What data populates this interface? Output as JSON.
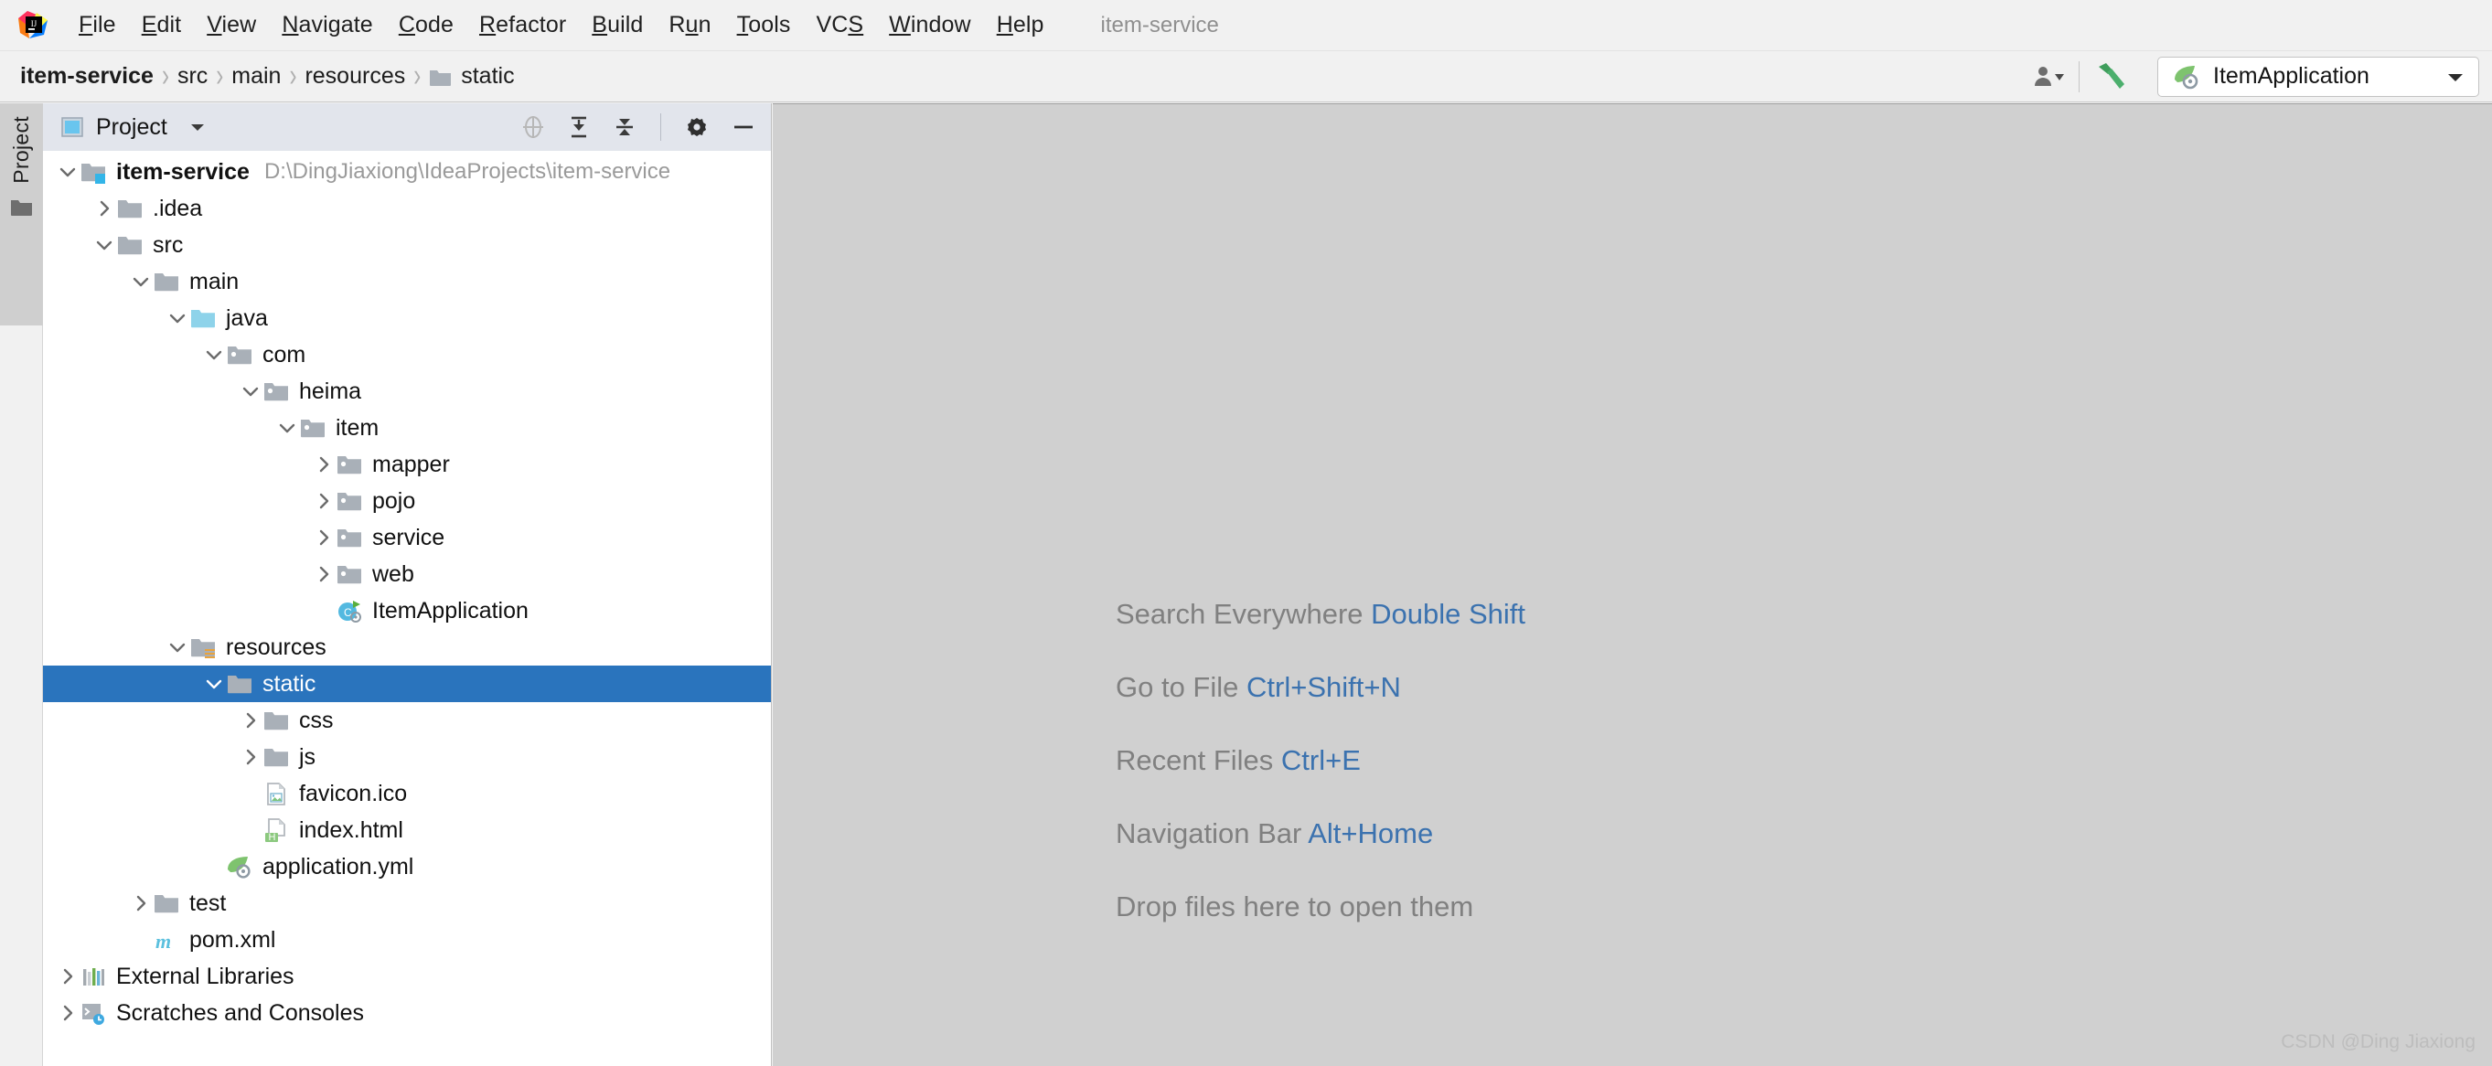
{
  "window": {
    "title": "item-service",
    "logo_icon": "intellij-idea-logo"
  },
  "menubar": {
    "items": [
      {
        "label": "File",
        "mnemonic": "F"
      },
      {
        "label": "Edit",
        "mnemonic": "E"
      },
      {
        "label": "View",
        "mnemonic": "V"
      },
      {
        "label": "Navigate",
        "mnemonic": "N"
      },
      {
        "label": "Code",
        "mnemonic": "C"
      },
      {
        "label": "Refactor",
        "mnemonic": "R"
      },
      {
        "label": "Build",
        "mnemonic": "B"
      },
      {
        "label": "Run",
        "mnemonic": "u"
      },
      {
        "label": "Tools",
        "mnemonic": "T"
      },
      {
        "label": "VCS",
        "mnemonic": "S"
      },
      {
        "label": "Window",
        "mnemonic": "W"
      },
      {
        "label": "Help",
        "mnemonic": "H"
      }
    ]
  },
  "navbar": {
    "breadcrumbs": [
      {
        "label": "item-service",
        "bold": true,
        "icon": null
      },
      {
        "label": "src",
        "bold": false,
        "icon": null
      },
      {
        "label": "main",
        "bold": false,
        "icon": null
      },
      {
        "label": "resources",
        "bold": false,
        "icon": null
      },
      {
        "label": "static",
        "bold": false,
        "icon": "folder-icon"
      }
    ],
    "separator": "›",
    "actions": {
      "account_icon": "user-account-icon",
      "account_caret_icon": "chevron-down-icon",
      "build_icon": "hammer-build-icon"
    },
    "run_config": {
      "icon": "spring-boot-leaf-icon",
      "label": "ItemApplication",
      "caret_icon": "chevron-down-icon"
    }
  },
  "toolstrip": {
    "active_tab": {
      "label": "Project",
      "icon": "project-folder-icon"
    }
  },
  "panel": {
    "icon": "project-view-icon",
    "title": "Project",
    "caret_icon": "chevron-down-icon",
    "actions": [
      {
        "name": "select-opened-file-icon",
        "label": "Select Opened File"
      },
      {
        "name": "expand-all-icon",
        "label": "Expand All"
      },
      {
        "name": "collapse-all-icon",
        "label": "Collapse All"
      },
      {
        "name": "settings-gear-icon",
        "label": "Settings"
      },
      {
        "name": "hide-minimize-icon",
        "label": "Hide"
      }
    ]
  },
  "tree": {
    "colors": {
      "selection_bg": "#2a74bd",
      "selection_fg": "#ffffff",
      "path_hint_fg": "#9a9a9a",
      "source_root": "#6cc2e0",
      "resource_root": "#e8a33d"
    },
    "rows": [
      {
        "depth": 0,
        "arrow": "down",
        "icon": "module-folder-icon",
        "label": "item-service",
        "bold": true,
        "sub": "D:\\DingJiaxiong\\IdeaProjects\\item-service",
        "selected": false
      },
      {
        "depth": 1,
        "arrow": "right",
        "icon": "folder-icon",
        "label": ".idea",
        "bold": false,
        "sub": "",
        "selected": false
      },
      {
        "depth": 1,
        "arrow": "down",
        "icon": "folder-icon",
        "label": "src",
        "bold": false,
        "sub": "",
        "selected": false
      },
      {
        "depth": 2,
        "arrow": "down",
        "icon": "folder-icon",
        "label": "main",
        "bold": false,
        "sub": "",
        "selected": false
      },
      {
        "depth": 3,
        "arrow": "down",
        "icon": "source-root-icon",
        "label": "java",
        "bold": false,
        "sub": "",
        "selected": false
      },
      {
        "depth": 4,
        "arrow": "down",
        "icon": "package-icon",
        "label": "com",
        "bold": false,
        "sub": "",
        "selected": false
      },
      {
        "depth": 5,
        "arrow": "down",
        "icon": "package-icon",
        "label": "heima",
        "bold": false,
        "sub": "",
        "selected": false
      },
      {
        "depth": 6,
        "arrow": "down",
        "icon": "package-icon",
        "label": "item",
        "bold": false,
        "sub": "",
        "selected": false
      },
      {
        "depth": 7,
        "arrow": "right",
        "icon": "package-icon",
        "label": "mapper",
        "bold": false,
        "sub": "",
        "selected": false
      },
      {
        "depth": 7,
        "arrow": "right",
        "icon": "package-icon",
        "label": "pojo",
        "bold": false,
        "sub": "",
        "selected": false
      },
      {
        "depth": 7,
        "arrow": "right",
        "icon": "package-icon",
        "label": "service",
        "bold": false,
        "sub": "",
        "selected": false
      },
      {
        "depth": 7,
        "arrow": "right",
        "icon": "package-icon",
        "label": "web",
        "bold": false,
        "sub": "",
        "selected": false
      },
      {
        "depth": 7,
        "arrow": "none",
        "icon": "java-class-run-icon",
        "label": "ItemApplication",
        "bold": false,
        "sub": "",
        "selected": false
      },
      {
        "depth": 3,
        "arrow": "down",
        "icon": "resource-root-icon",
        "label": "resources",
        "bold": false,
        "sub": "",
        "selected": false
      },
      {
        "depth": 4,
        "arrow": "down",
        "icon": "folder-icon",
        "label": "static",
        "bold": false,
        "sub": "",
        "selected": true
      },
      {
        "depth": 5,
        "arrow": "right",
        "icon": "folder-icon",
        "label": "css",
        "bold": false,
        "sub": "",
        "selected": false
      },
      {
        "depth": 5,
        "arrow": "right",
        "icon": "folder-icon",
        "label": "js",
        "bold": false,
        "sub": "",
        "selected": false
      },
      {
        "depth": 5,
        "arrow": "none",
        "icon": "image-file-icon",
        "label": "favicon.ico",
        "bold": false,
        "sub": "",
        "selected": false
      },
      {
        "depth": 5,
        "arrow": "none",
        "icon": "html-file-icon",
        "label": "index.html",
        "bold": false,
        "sub": "",
        "selected": false
      },
      {
        "depth": 4,
        "arrow": "none",
        "icon": "spring-yml-icon",
        "label": "application.yml",
        "bold": false,
        "sub": "",
        "selected": false
      },
      {
        "depth": 2,
        "arrow": "right",
        "icon": "folder-icon",
        "label": "test",
        "bold": false,
        "sub": "",
        "selected": false
      },
      {
        "depth": 2,
        "arrow": "none",
        "icon": "maven-pom-icon",
        "label": "pom.xml",
        "bold": false,
        "sub": "",
        "selected": false
      },
      {
        "depth": 0,
        "arrow": "right",
        "icon": "external-libraries-icon",
        "label": "External Libraries",
        "bold": false,
        "sub": "",
        "selected": false
      },
      {
        "depth": 0,
        "arrow": "right",
        "icon": "scratches-icon",
        "label": "Scratches and Consoles",
        "bold": false,
        "sub": "",
        "selected": false
      }
    ]
  },
  "editor": {
    "background": "#d0d0d0",
    "hint_color": "#808080",
    "shortcut_color": "#3b72af",
    "hints": [
      {
        "text": "Search Everywhere",
        "shortcut": "Double Shift"
      },
      {
        "text": "Go to File",
        "shortcut": "Ctrl+Shift+N"
      },
      {
        "text": "Recent Files",
        "shortcut": "Ctrl+E"
      },
      {
        "text": "Navigation Bar",
        "shortcut": "Alt+Home"
      },
      {
        "text": "Drop files here to open them",
        "shortcut": ""
      }
    ],
    "watermark": "CSDN @Ding Jiaxiong"
  }
}
